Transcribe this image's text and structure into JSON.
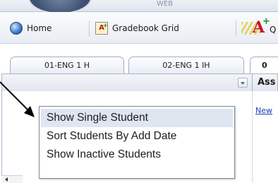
{
  "banner": {
    "text": "WEB"
  },
  "toolbar": {
    "home_label": "Home",
    "gradebook_grid_label": "Gradebook Grid",
    "next_label_fragment": "Q"
  },
  "tabs": [
    {
      "label": "01-ENG 1 H"
    },
    {
      "label": "02-ENG 1 IH"
    },
    {
      "label": "0"
    }
  ],
  "grid": {
    "assignment_header": "Ass",
    "new_link": "New"
  },
  "context_menu": {
    "items": [
      {
        "label": "Show Single Student"
      },
      {
        "label": "Sort Students By Add Date"
      },
      {
        "label": "Show Inactive Students"
      }
    ]
  },
  "icons": {
    "home": "globe-icon",
    "gradebook_grid": "grade-grid-icon",
    "next": "grade-a-plus-icon",
    "dropdown": "chevron-down-icon",
    "scroll": "scroll-left-icon"
  },
  "colors": {
    "menu_hover": "#dfe6f1",
    "link": "#1a3fb0",
    "tab_border": "#9eadc4"
  }
}
